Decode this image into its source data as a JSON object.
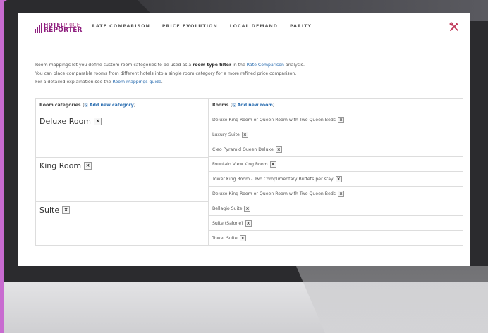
{
  "colors": {
    "brand": "#8e1e7e",
    "link": "#2a6db0",
    "tools_icon": "#c0395a",
    "desktop": "#c86bd0"
  },
  "logo": {
    "line1_bold": "HOTEL",
    "line1_light": "PRICE",
    "line2": "REPORTER"
  },
  "nav": {
    "items": [
      "RATE COMPARISON",
      "PRICE EVOLUTION",
      "LOCAL DEMAND",
      "PARITY"
    ],
    "tools_icon": "tools-icon"
  },
  "intro": {
    "line1_a": "Room mappings let you define custom room categories to be used as a ",
    "line1_bold": "room type filter",
    "line1_b": " in the ",
    "line1_link": "Rate Comparison",
    "line1_c": " analysis.",
    "line2": "You can place comparable rooms from different hotels into a single room category for a more refined price comparison.",
    "line3_a": "For a detailed explaination see the ",
    "line3_link": "Room mappings guide",
    "line3_b": "."
  },
  "table": {
    "col1_label": "Room categories (",
    "col1_add": "Add new category",
    "col2_label": "Rooms (",
    "col2_add": "Add new room",
    "close_paren": ")",
    "remove_glyph": "×",
    "add_icon_glyph": "⎘",
    "categories": [
      {
        "name": "Deluxe Room",
        "rooms": [
          "Deluxe King Room or Queen Room with Two Queen Beds",
          "Luxury Suite",
          "Cleo Pyramid Queen Deluxe"
        ]
      },
      {
        "name": "King Room",
        "rooms": [
          "Fountain View King Room",
          "Tower King Room - Two Complimentary Buffets per stay",
          "Deluxe King Room or Queen Room with Two Queen Beds"
        ]
      },
      {
        "name": "Suite",
        "rooms": [
          "Bellagio Suite",
          "Suite (Salone)",
          "Tower Suite"
        ]
      }
    ]
  }
}
